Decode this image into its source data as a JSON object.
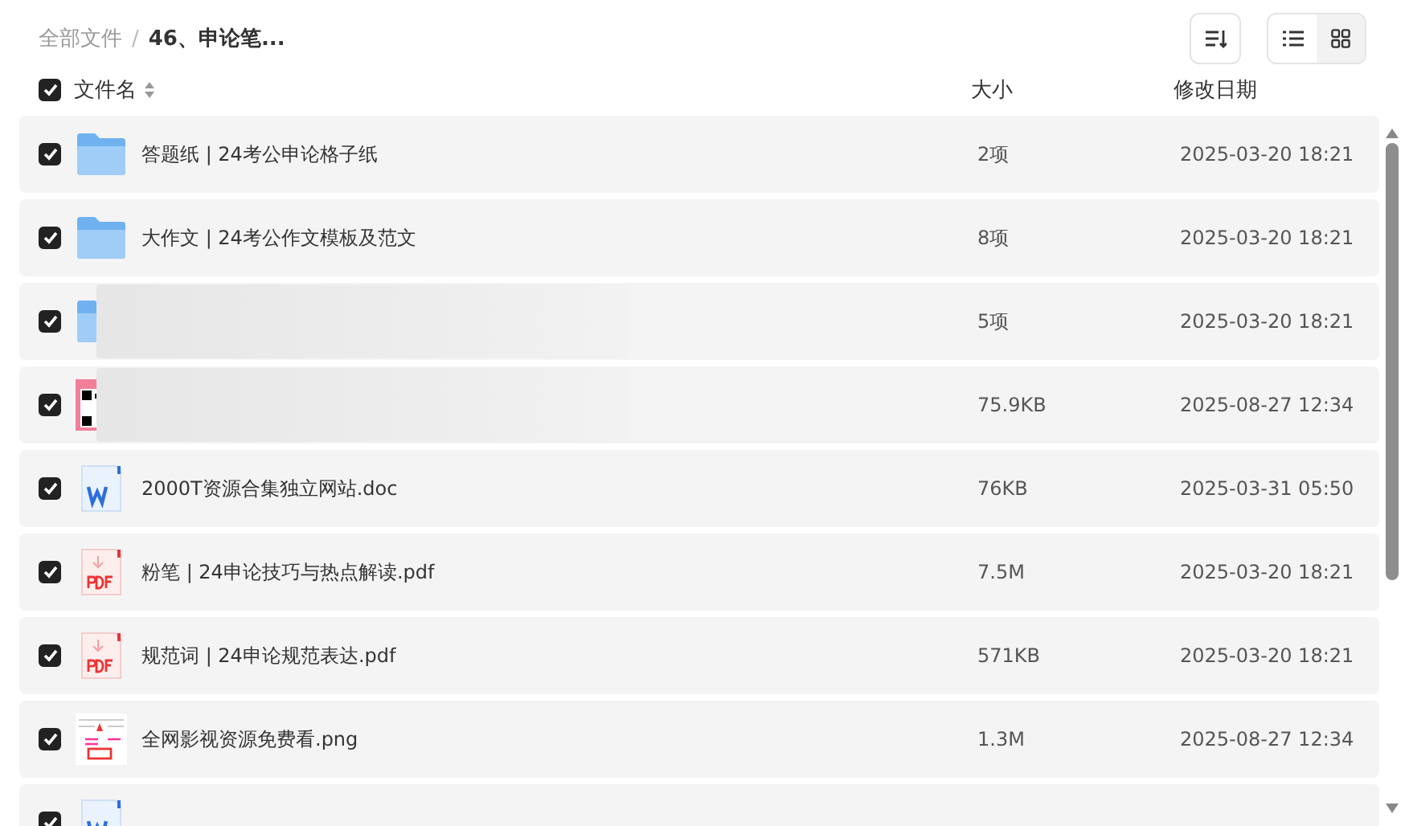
{
  "breadcrumb": {
    "root": "全部文件",
    "separator": "/",
    "current": "46、申论笔..."
  },
  "toolbar": {
    "views": [
      {
        "kind": "list",
        "selected": false
      },
      {
        "kind": "grid",
        "selected": true
      }
    ]
  },
  "table": {
    "all_checked": true,
    "columns": [
      {
        "label": "文件名",
        "sortable": true
      },
      {
        "label": "大小",
        "sortable": false
      },
      {
        "label": "修改日期",
        "sortable": false
      }
    ],
    "rows": [
      {
        "kind": "folder",
        "checked": true,
        "name": "答题纸 | 24考公申论格子纸",
        "size": "2项",
        "date": "2025-03-20 18:21"
      },
      {
        "kind": "folder",
        "checked": true,
        "name": "大作文 | 24考公作文模板及范文",
        "size": "8项",
        "date": "2025-03-20 18:21"
      },
      {
        "kind": "folder",
        "checked": true,
        "redacted": true,
        "size": "5项",
        "date": "2025-03-20 18:21"
      },
      {
        "kind": "qr-image",
        "checked": true,
        "redacted": true,
        "size": "75.9KB",
        "date": "2025-08-27 12:34"
      },
      {
        "kind": "word",
        "checked": true,
        "name": "2000T资源合集独立网站.doc",
        "size": "76KB",
        "date": "2025-03-31 05:50"
      },
      {
        "kind": "pdf",
        "checked": true,
        "name": "粉笔 | 24申论技巧与热点解读.pdf",
        "size": "7.5M",
        "date": "2025-03-20 18:21"
      },
      {
        "kind": "pdf",
        "checked": true,
        "name": "规范词 | 24申论规范表达.pdf",
        "size": "571KB",
        "date": "2025-03-20 18:21"
      },
      {
        "kind": "image",
        "checked": true,
        "name": "全网影视资源免费看.png",
        "size": "1.3M",
        "date": "2025-08-27 12:34"
      },
      {
        "kind": "word",
        "checked": true
      }
    ]
  }
}
